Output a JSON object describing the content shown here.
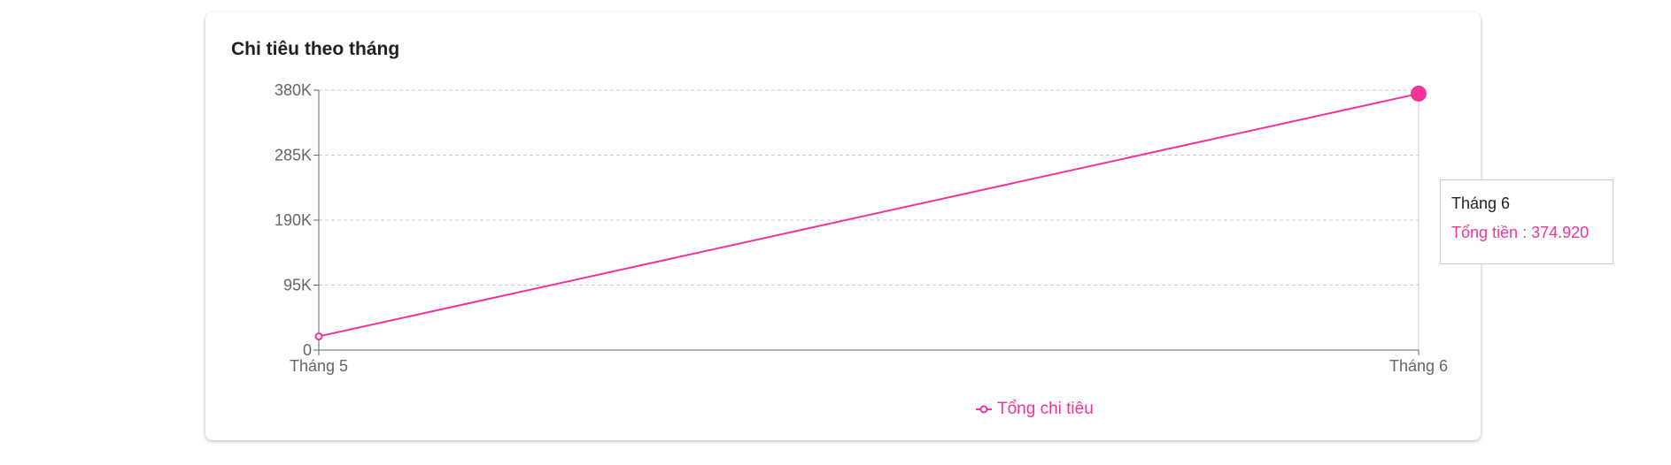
{
  "card": {
    "title": "Chi tiêu theo tháng"
  },
  "tooltip": {
    "title": "Tháng 6",
    "label": "Tổng tiền",
    "separator": " : ",
    "value": "374.920"
  },
  "legend": {
    "label": "Tổng chi tiêu"
  },
  "colors": {
    "series": "#f2349a",
    "grid": "#cccccc",
    "axis": "#666666",
    "title": "#1f1f1f"
  },
  "chart_data": {
    "type": "line",
    "title": "Chi tiêu theo tháng",
    "categories": [
      "Tháng 5",
      "Tháng 6"
    ],
    "series": [
      {
        "name": "Tổng chi tiêu",
        "values": [
          20000,
          374920
        ]
      }
    ],
    "y_ticks": [
      0,
      95000,
      190000,
      285000,
      380000
    ],
    "y_tick_labels": [
      "0",
      "95K",
      "190K",
      "285K",
      "380K"
    ],
    "ylim": [
      0,
      380000
    ],
    "grid": true,
    "legend_position": "bottom"
  }
}
